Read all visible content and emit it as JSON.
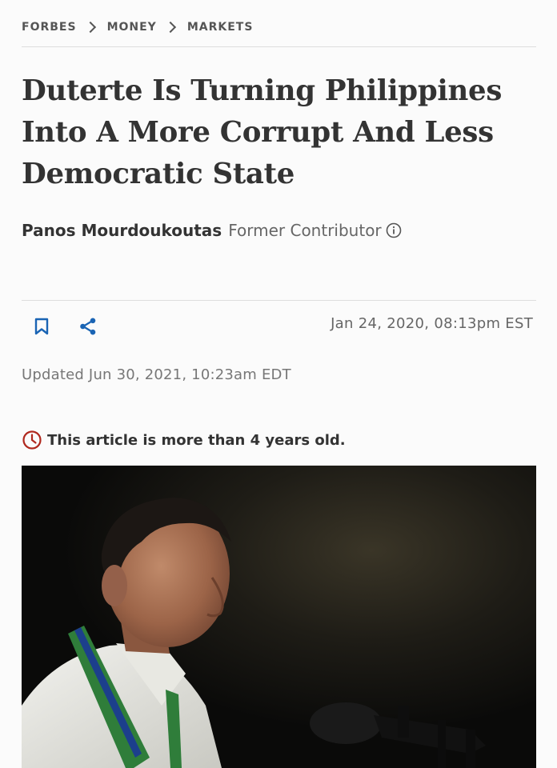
{
  "breadcrumb": {
    "items": [
      "FORBES",
      "MONEY",
      "MARKETS"
    ]
  },
  "article": {
    "headline": "Duterte Is Turning Philippines Into A More Corrupt And Less Democratic State",
    "author": "Panos Mourdoukoutas",
    "author_role": "Former Contributor",
    "published": "Jan 24, 2020,  08:13pm EST",
    "updated": "Updated Jun 30, 2021, 10:23am EDT",
    "age_notice": "This article is more than 4 years old."
  },
  "icons": {
    "bookmark": "bookmark-icon",
    "share": "share-icon",
    "info": "info-icon",
    "clock": "clock-icon"
  },
  "colors": {
    "accent_blue": "#1a64b4",
    "notice_red": "#b0281e",
    "text_dark": "#333333",
    "text_muted": "#666666",
    "rule": "#dedede"
  }
}
